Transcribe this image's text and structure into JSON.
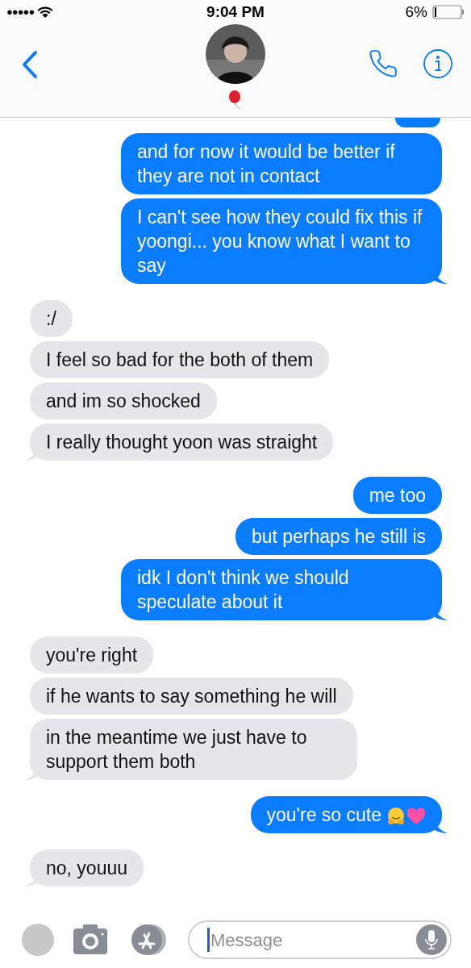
{
  "status_bar": {
    "signal_dots": "●●●●●",
    "time": "9:04 PM",
    "battery": "6%"
  },
  "groups": [
    {
      "kind": "sent",
      "messages": [
        {
          "text": "and for now it would be better if they are not in contact"
        },
        {
          "text": "I can't see how they could fix this if yoongi... you know what I want to say"
        }
      ]
    },
    {
      "kind": "received",
      "messages": [
        {
          "text": ":/"
        },
        {
          "text": "I feel so bad for the both of them"
        },
        {
          "text": "and im so shocked"
        },
        {
          "text": "I really thought yoon was straight"
        }
      ]
    },
    {
      "kind": "sent",
      "messages": [
        {
          "text": "me too"
        },
        {
          "text": "but perhaps he still is"
        },
        {
          "text": "idk I don't think we should speculate about it"
        }
      ]
    },
    {
      "kind": "received",
      "messages": [
        {
          "text": "you're right"
        },
        {
          "text": "if he wants to say something he will"
        },
        {
          "text": "in the meantime we just have to support them both"
        }
      ]
    },
    {
      "kind": "sent",
      "messages": [
        {
          "text": "you're so cute",
          "emoji": true
        }
      ]
    },
    {
      "kind": "received",
      "messages": [
        {
          "text": "no, youuu"
        }
      ]
    }
  ],
  "composer": {
    "placeholder": "Message"
  }
}
